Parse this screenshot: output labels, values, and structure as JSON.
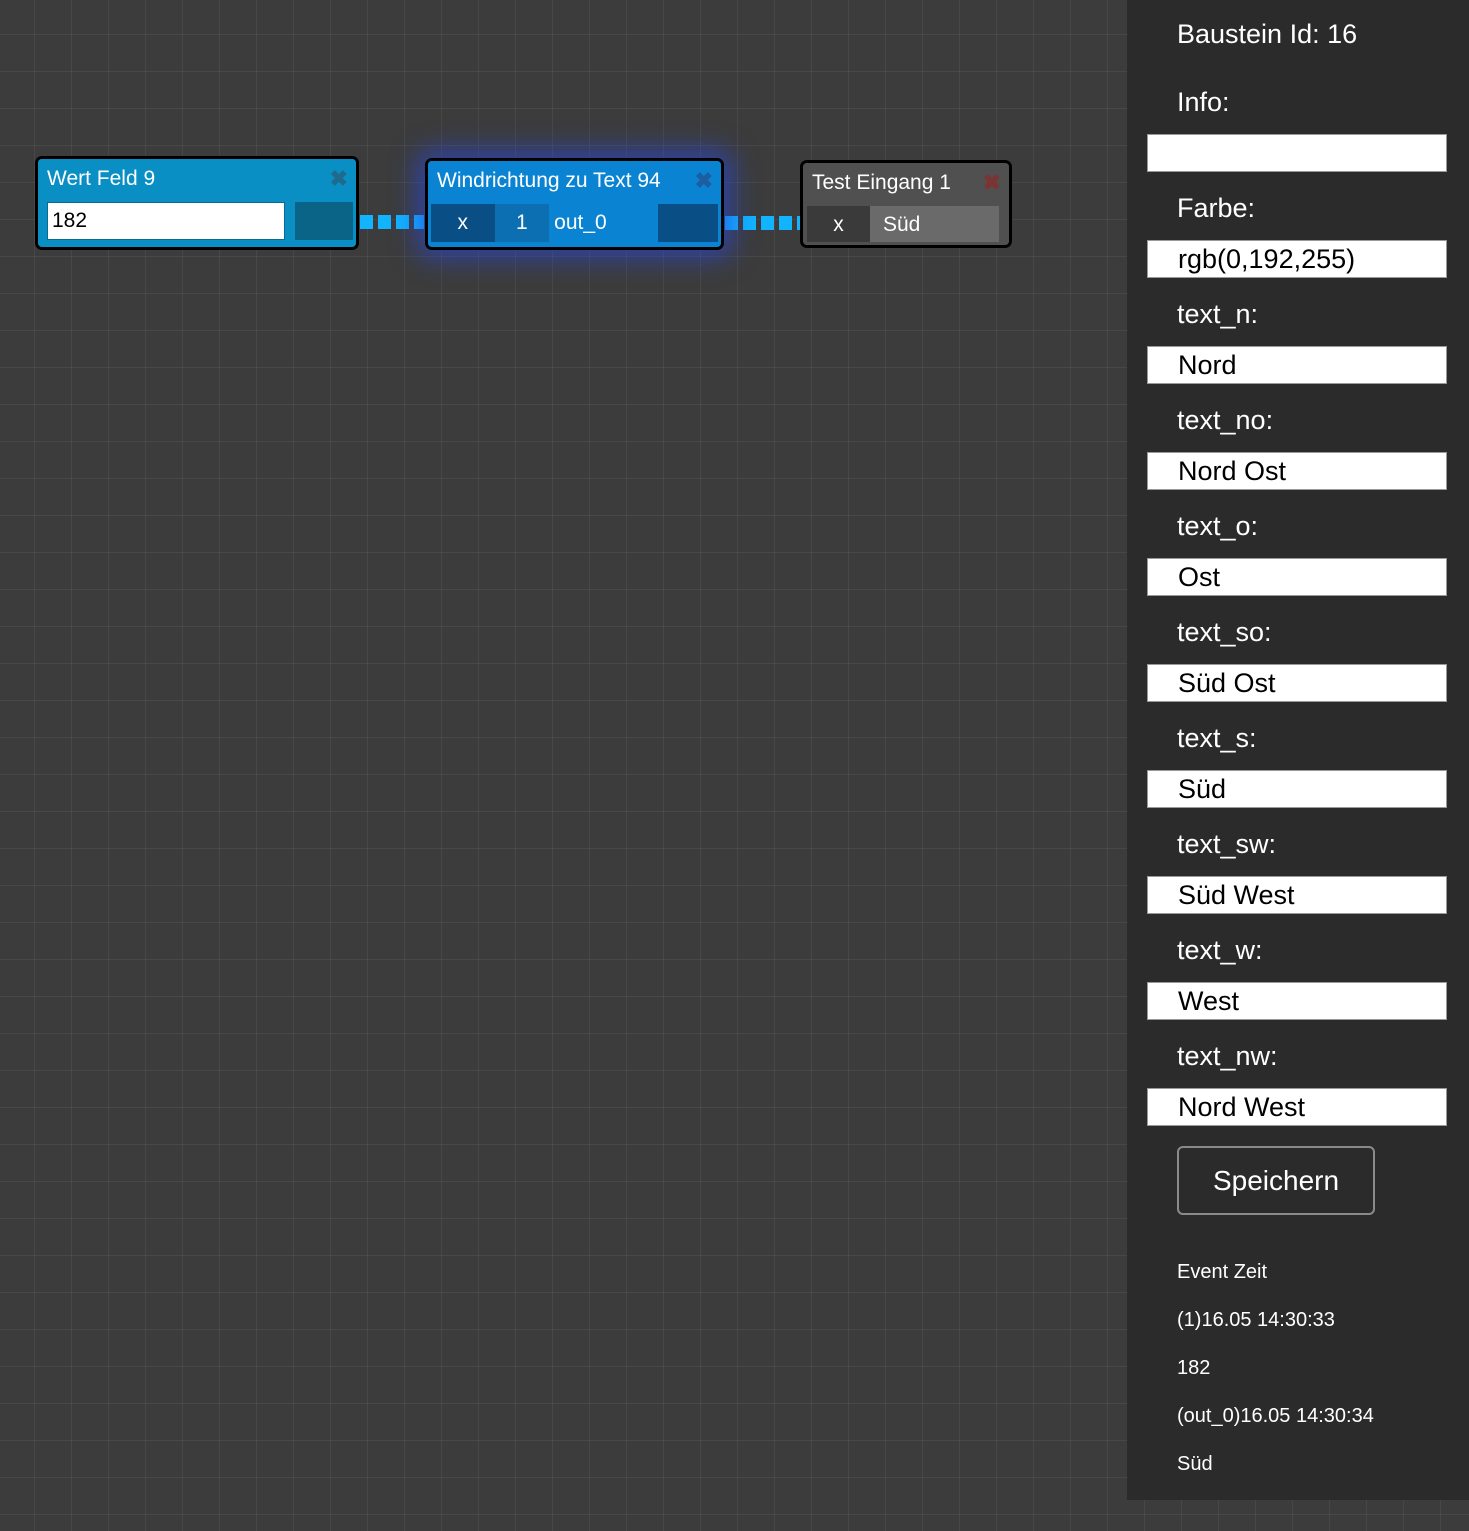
{
  "nodes": {
    "wert_feld": {
      "title": "Wert Feld 9",
      "close": "✖",
      "value": "182"
    },
    "windrichtung": {
      "title": "Windrichtung zu Text 94",
      "close": "✖",
      "input_label": "x",
      "input_value": "1",
      "output_label": "out_0"
    },
    "test_eingang": {
      "title": "Test Eingang 1",
      "close": "✖",
      "input_label": "x",
      "value": "Süd"
    }
  },
  "panel": {
    "title": "Baustein Id: 16",
    "fields": [
      {
        "label": "Info:",
        "value": ""
      },
      {
        "label": "Farbe:",
        "value": "rgb(0,192,255)"
      },
      {
        "label": "text_n:",
        "value": "Nord"
      },
      {
        "label": "text_no:",
        "value": "Nord Ost"
      },
      {
        "label": "text_o:",
        "value": "Ost"
      },
      {
        "label": "text_so:",
        "value": "Süd Ost"
      },
      {
        "label": "text_s:",
        "value": "Süd"
      },
      {
        "label": "text_sw:",
        "value": "Süd West"
      },
      {
        "label": "text_w:",
        "value": "West"
      },
      {
        "label": "text_nw:",
        "value": "Nord West"
      }
    ],
    "save_label": "Speichern",
    "event_log": [
      "Event Zeit",
      "(1)16.05 14:30:33",
      "182",
      "(out_0)16.05 14:30:34",
      "Süd"
    ]
  },
  "colors": {
    "canvas_bg": "#3c3c3c",
    "panel_bg": "#2b2b2b",
    "node_blue": "#0a8fc4",
    "node_selected": "#0a84d2",
    "node_gray": "#505050",
    "wire": "#12b4ff"
  }
}
